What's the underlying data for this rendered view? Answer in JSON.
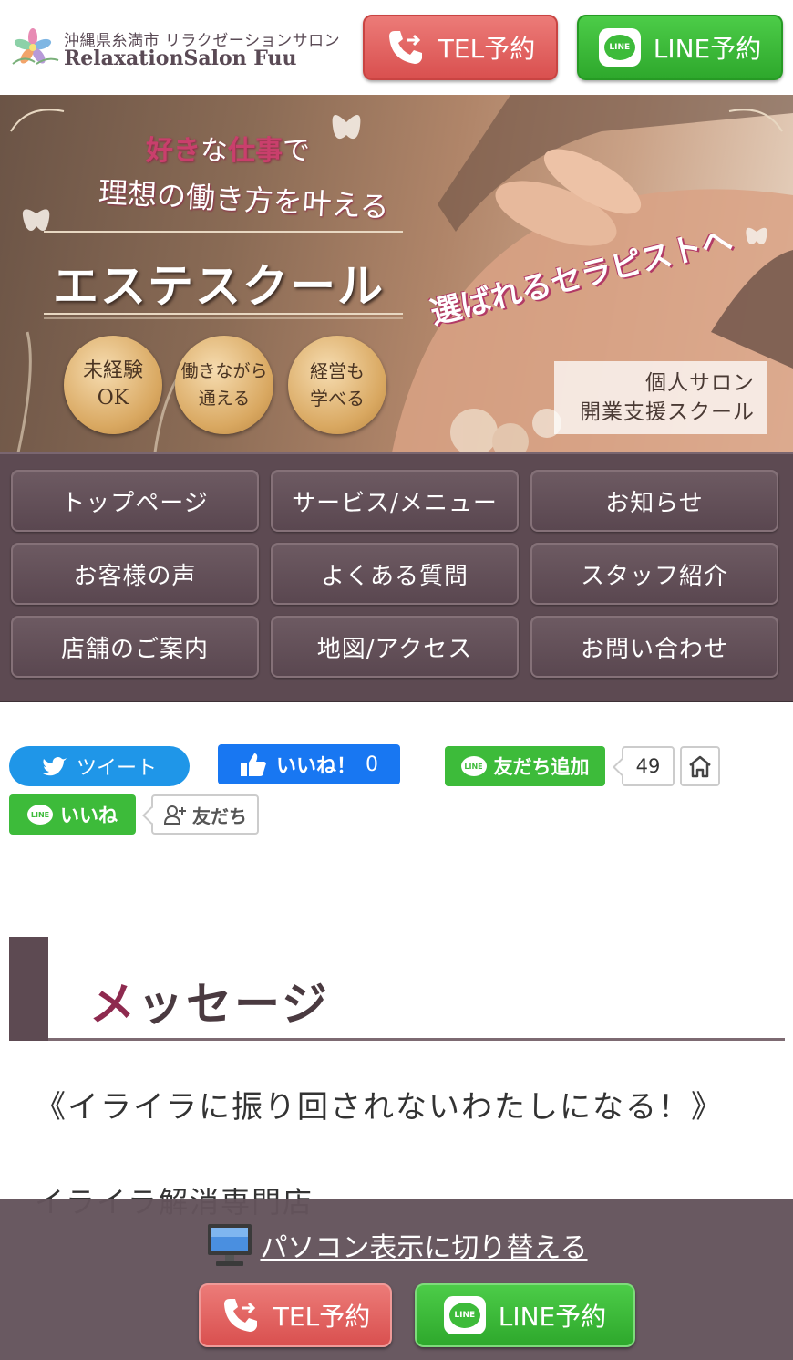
{
  "header": {
    "logo_sub": "沖縄県糸満市 リラクゼーションサロン",
    "logo_main": "RelaxationSalon Fuu",
    "tel_button": "TEL予約",
    "line_button": "LINE予約",
    "line_badge": "LINE"
  },
  "hero": {
    "line1_a": "好き",
    "line1_b": "な",
    "line1_c": "仕事",
    "line1_d": "で",
    "line2": "理想の働き方を叶える",
    "title": "エステスクール",
    "tagline": "選ばれるセラピストへ",
    "badges": [
      "未経験\nOK",
      "働きながら\n通える",
      "経営も\n学べる"
    ],
    "box_line1": "個人サロン",
    "box_line2": "開業支援スクール"
  },
  "nav": {
    "items": [
      {
        "label": "トップページ"
      },
      {
        "label": "サービス/メニュー"
      },
      {
        "label": "お知らせ"
      },
      {
        "label": "お客様の声"
      },
      {
        "label": "よくある質問"
      },
      {
        "label": "スタッフ紹介"
      },
      {
        "label": "店舗のご案内"
      },
      {
        "label": "地図/アクセス"
      },
      {
        "label": "お問い合わせ"
      }
    ]
  },
  "social": {
    "tweet": "ツイート",
    "fb_like": "いいね！",
    "fb_count": "0",
    "line_add": "友だち追加",
    "line_add_count": "49",
    "line_like": "いいね",
    "friend": "友だち",
    "line_mini": "LINE"
  },
  "message": {
    "title_accent": "メ",
    "title_rest": "ッセージ",
    "text1": "《イライラに振り回されないわたしになる！》",
    "text2": "イライラ解消専門店"
  },
  "footer": {
    "pc_link": "パソコン表示に切り替える",
    "tel_button": "TEL予約",
    "line_button": "LINE予約"
  },
  "colors": {
    "nav_bg": "#5d4a52",
    "tel_red": "#d9504f",
    "line_green": "#3dbb3a",
    "accent": "#8e2a4f"
  }
}
